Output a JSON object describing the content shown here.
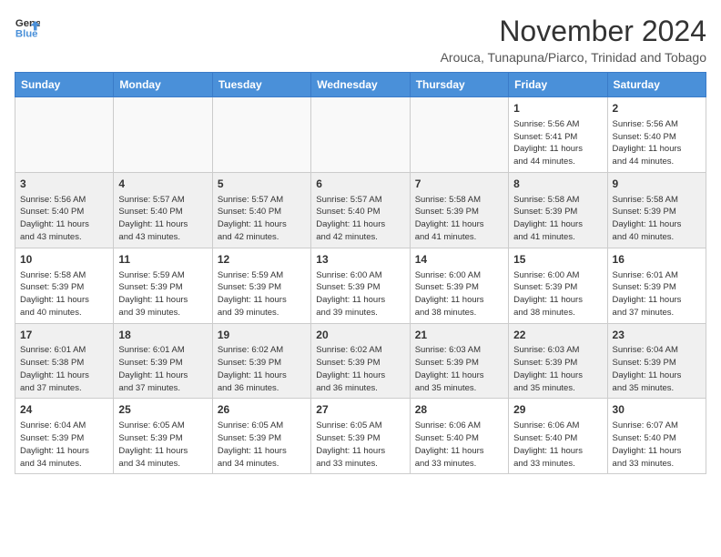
{
  "header": {
    "logo_line1": "General",
    "logo_line2": "Blue",
    "month": "November 2024",
    "location": "Arouca, Tunapuna/Piarco, Trinidad and Tobago"
  },
  "weekdays": [
    "Sunday",
    "Monday",
    "Tuesday",
    "Wednesday",
    "Thursday",
    "Friday",
    "Saturday"
  ],
  "rows": [
    {
      "shaded": false,
      "days": [
        {
          "num": "",
          "info": ""
        },
        {
          "num": "",
          "info": ""
        },
        {
          "num": "",
          "info": ""
        },
        {
          "num": "",
          "info": ""
        },
        {
          "num": "",
          "info": ""
        },
        {
          "num": "1",
          "info": "Sunrise: 5:56 AM\nSunset: 5:41 PM\nDaylight: 11 hours\nand 44 minutes."
        },
        {
          "num": "2",
          "info": "Sunrise: 5:56 AM\nSunset: 5:40 PM\nDaylight: 11 hours\nand 44 minutes."
        }
      ]
    },
    {
      "shaded": true,
      "days": [
        {
          "num": "3",
          "info": "Sunrise: 5:56 AM\nSunset: 5:40 PM\nDaylight: 11 hours\nand 43 minutes."
        },
        {
          "num": "4",
          "info": "Sunrise: 5:57 AM\nSunset: 5:40 PM\nDaylight: 11 hours\nand 43 minutes."
        },
        {
          "num": "5",
          "info": "Sunrise: 5:57 AM\nSunset: 5:40 PM\nDaylight: 11 hours\nand 42 minutes."
        },
        {
          "num": "6",
          "info": "Sunrise: 5:57 AM\nSunset: 5:40 PM\nDaylight: 11 hours\nand 42 minutes."
        },
        {
          "num": "7",
          "info": "Sunrise: 5:58 AM\nSunset: 5:39 PM\nDaylight: 11 hours\nand 41 minutes."
        },
        {
          "num": "8",
          "info": "Sunrise: 5:58 AM\nSunset: 5:39 PM\nDaylight: 11 hours\nand 41 minutes."
        },
        {
          "num": "9",
          "info": "Sunrise: 5:58 AM\nSunset: 5:39 PM\nDaylight: 11 hours\nand 40 minutes."
        }
      ]
    },
    {
      "shaded": false,
      "days": [
        {
          "num": "10",
          "info": "Sunrise: 5:58 AM\nSunset: 5:39 PM\nDaylight: 11 hours\nand 40 minutes."
        },
        {
          "num": "11",
          "info": "Sunrise: 5:59 AM\nSunset: 5:39 PM\nDaylight: 11 hours\nand 39 minutes."
        },
        {
          "num": "12",
          "info": "Sunrise: 5:59 AM\nSunset: 5:39 PM\nDaylight: 11 hours\nand 39 minutes."
        },
        {
          "num": "13",
          "info": "Sunrise: 6:00 AM\nSunset: 5:39 PM\nDaylight: 11 hours\nand 39 minutes."
        },
        {
          "num": "14",
          "info": "Sunrise: 6:00 AM\nSunset: 5:39 PM\nDaylight: 11 hours\nand 38 minutes."
        },
        {
          "num": "15",
          "info": "Sunrise: 6:00 AM\nSunset: 5:39 PM\nDaylight: 11 hours\nand 38 minutes."
        },
        {
          "num": "16",
          "info": "Sunrise: 6:01 AM\nSunset: 5:39 PM\nDaylight: 11 hours\nand 37 minutes."
        }
      ]
    },
    {
      "shaded": true,
      "days": [
        {
          "num": "17",
          "info": "Sunrise: 6:01 AM\nSunset: 5:38 PM\nDaylight: 11 hours\nand 37 minutes."
        },
        {
          "num": "18",
          "info": "Sunrise: 6:01 AM\nSunset: 5:39 PM\nDaylight: 11 hours\nand 37 minutes."
        },
        {
          "num": "19",
          "info": "Sunrise: 6:02 AM\nSunset: 5:39 PM\nDaylight: 11 hours\nand 36 minutes."
        },
        {
          "num": "20",
          "info": "Sunrise: 6:02 AM\nSunset: 5:39 PM\nDaylight: 11 hours\nand 36 minutes."
        },
        {
          "num": "21",
          "info": "Sunrise: 6:03 AM\nSunset: 5:39 PM\nDaylight: 11 hours\nand 35 minutes."
        },
        {
          "num": "22",
          "info": "Sunrise: 6:03 AM\nSunset: 5:39 PM\nDaylight: 11 hours\nand 35 minutes."
        },
        {
          "num": "23",
          "info": "Sunrise: 6:04 AM\nSunset: 5:39 PM\nDaylight: 11 hours\nand 35 minutes."
        }
      ]
    },
    {
      "shaded": false,
      "days": [
        {
          "num": "24",
          "info": "Sunrise: 6:04 AM\nSunset: 5:39 PM\nDaylight: 11 hours\nand 34 minutes."
        },
        {
          "num": "25",
          "info": "Sunrise: 6:05 AM\nSunset: 5:39 PM\nDaylight: 11 hours\nand 34 minutes."
        },
        {
          "num": "26",
          "info": "Sunrise: 6:05 AM\nSunset: 5:39 PM\nDaylight: 11 hours\nand 34 minutes."
        },
        {
          "num": "27",
          "info": "Sunrise: 6:05 AM\nSunset: 5:39 PM\nDaylight: 11 hours\nand 33 minutes."
        },
        {
          "num": "28",
          "info": "Sunrise: 6:06 AM\nSunset: 5:40 PM\nDaylight: 11 hours\nand 33 minutes."
        },
        {
          "num": "29",
          "info": "Sunrise: 6:06 AM\nSunset: 5:40 PM\nDaylight: 11 hours\nand 33 minutes."
        },
        {
          "num": "30",
          "info": "Sunrise: 6:07 AM\nSunset: 5:40 PM\nDaylight: 11 hours\nand 33 minutes."
        }
      ]
    }
  ]
}
